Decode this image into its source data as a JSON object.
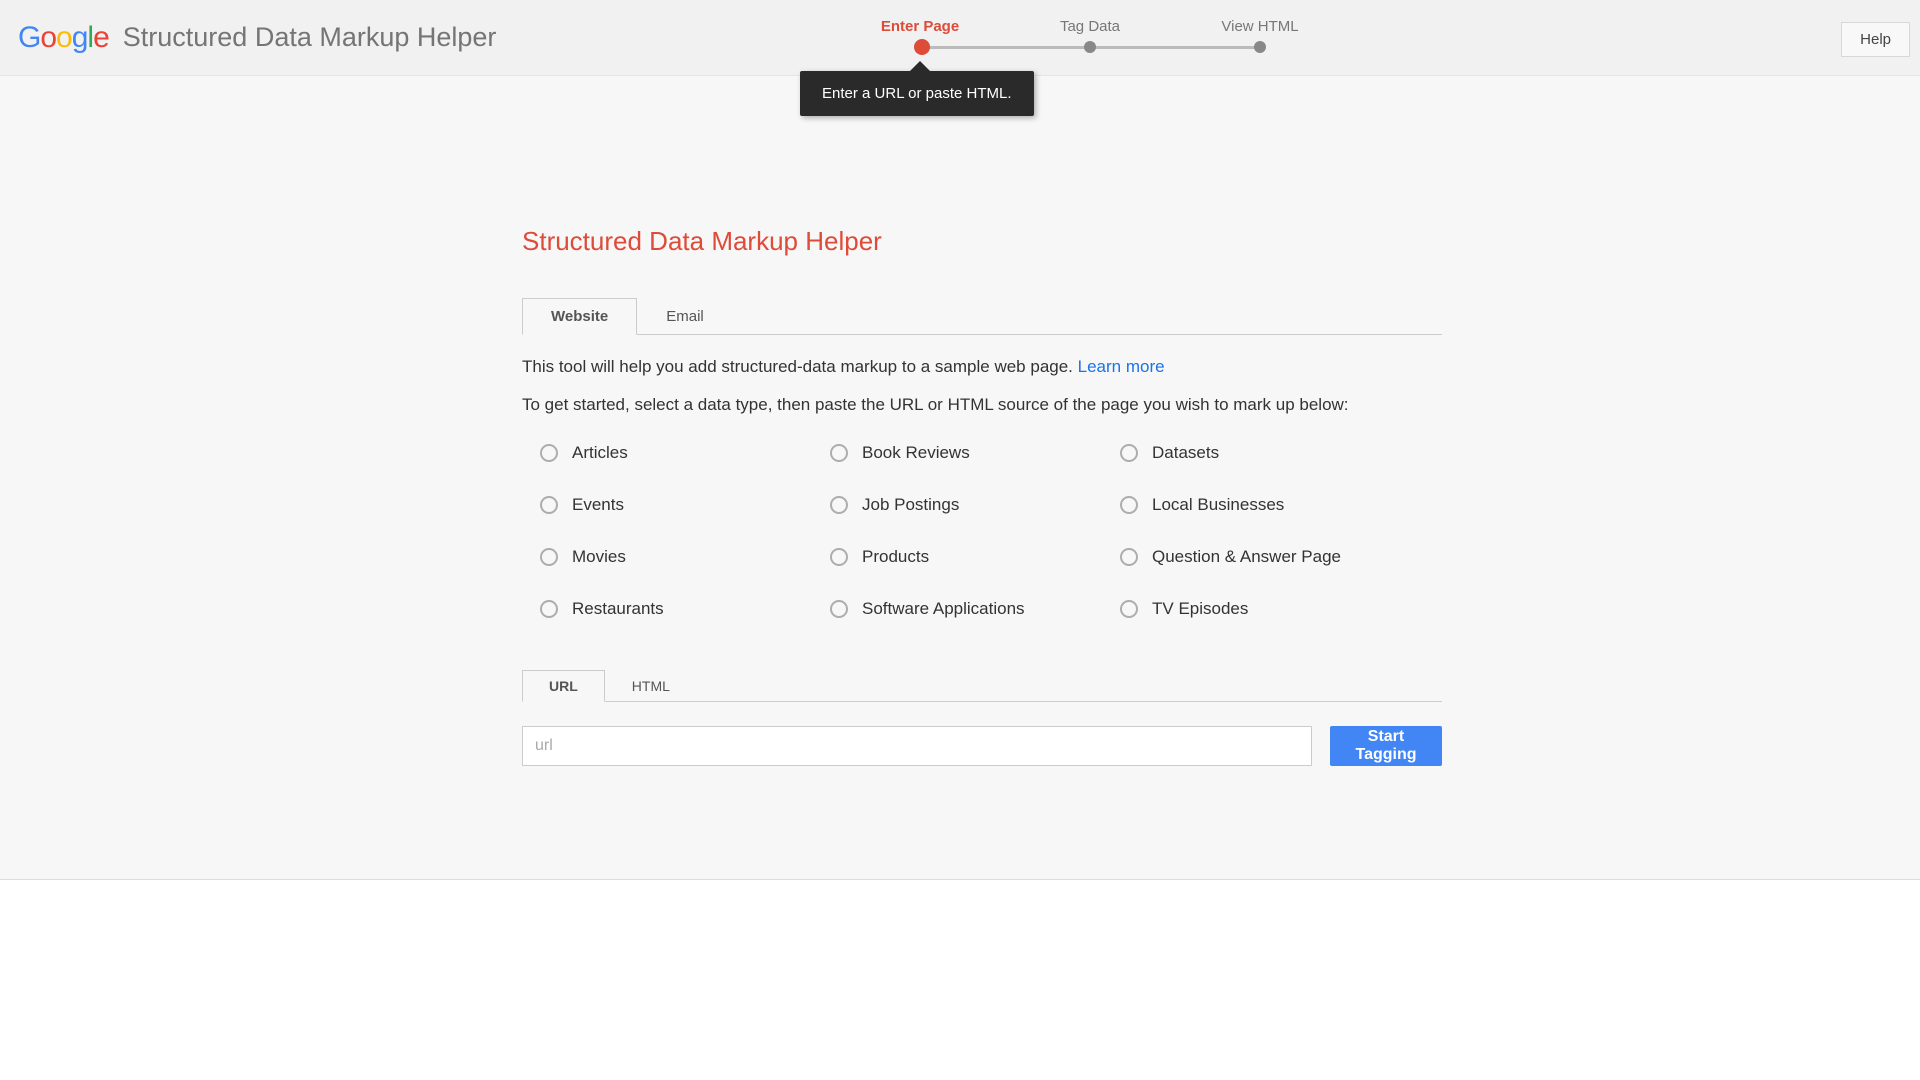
{
  "header": {
    "app_title": "Structured Data Markup Helper",
    "help_label": "Help",
    "steps": [
      "Enter Page",
      "Tag Data",
      "View HTML"
    ],
    "active_step": 0,
    "tooltip": "Enter a URL or paste HTML."
  },
  "main": {
    "title": "Structured Data Markup Helper",
    "type_tabs": {
      "active": "Website",
      "other": "Email"
    },
    "intro_text": "This tool will help you add structured-data markup to a sample web page. ",
    "learn_more": "Learn more",
    "instruction": "To get started, select a data type, then paste the URL or HTML source of the page you wish to mark up below:",
    "data_types": [
      "Articles",
      "Book Reviews",
      "Datasets",
      "Events",
      "Job Postings",
      "Local Businesses",
      "Movies",
      "Products",
      "Question & Answer Page",
      "Restaurants",
      "Software Applications",
      "TV Episodes"
    ],
    "input_tabs": {
      "active": "URL",
      "other": "HTML"
    },
    "url_placeholder": "url",
    "start_button": "Start Tagging"
  }
}
